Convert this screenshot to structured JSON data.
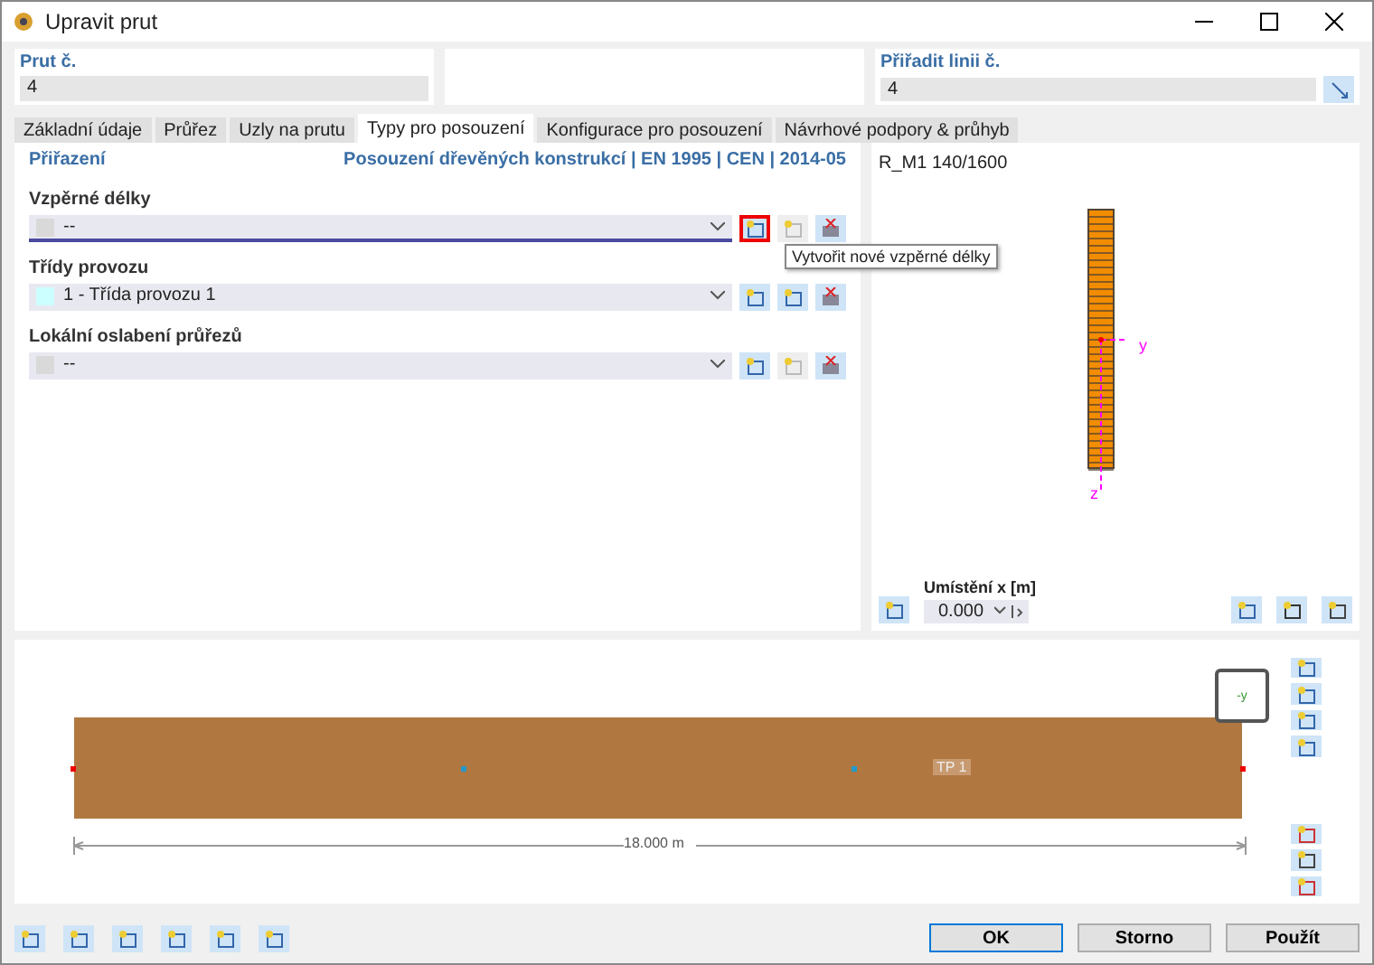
{
  "window": {
    "title": "Upravit prut"
  },
  "member": {
    "label": "Prut č.",
    "value": "4"
  },
  "assign_line": {
    "label": "Přiřadit linii č.",
    "value": "4"
  },
  "tabs": [
    {
      "label": "Základní údaje",
      "selected": false
    },
    {
      "label": "Průřez",
      "selected": false
    },
    {
      "label": "Uzly na prutu",
      "selected": false
    },
    {
      "label": "Typy pro posouzení",
      "selected": true
    },
    {
      "label": "Konfigurace pro posouzení",
      "selected": false
    },
    {
      "label": "Návrhové podpory & průhyb",
      "selected": false
    }
  ],
  "assignment": {
    "title": "Přiřazení",
    "standard": "Posouzení dřevěných konstrukcí | EN 1995 | CEN | 2014-05"
  },
  "fields": [
    {
      "label": "Vzpěrné délky",
      "value": "--",
      "color": "#d9d9d9",
      "focused": true,
      "new_highlighted": true,
      "edit_disabled": true
    },
    {
      "label": "Třídy provozu",
      "value": "1 - Třída provozu 1",
      "color": "#ccffff",
      "focused": false,
      "new_highlighted": false,
      "edit_disabled": false
    },
    {
      "label": "Lokální oslabení průřezů",
      "value": "--",
      "color": "#d9d9d9",
      "focused": false,
      "new_highlighted": false,
      "edit_disabled": true
    }
  ],
  "tooltip": "Vytvořit nové vzpěrné délky",
  "preview": {
    "title": "R_M1 140/1600",
    "axis_y": "y",
    "axis_z": "z",
    "location_label": "Umístění x [m]",
    "location_value": "0.000"
  },
  "beam": {
    "label": "TP 1",
    "dimension": "18.000 m",
    "view_label": "-y"
  },
  "buttons": [
    {
      "label": "OK",
      "default": true
    },
    {
      "label": "Storno",
      "default": false
    },
    {
      "label": "Použít",
      "default": false
    }
  ]
}
